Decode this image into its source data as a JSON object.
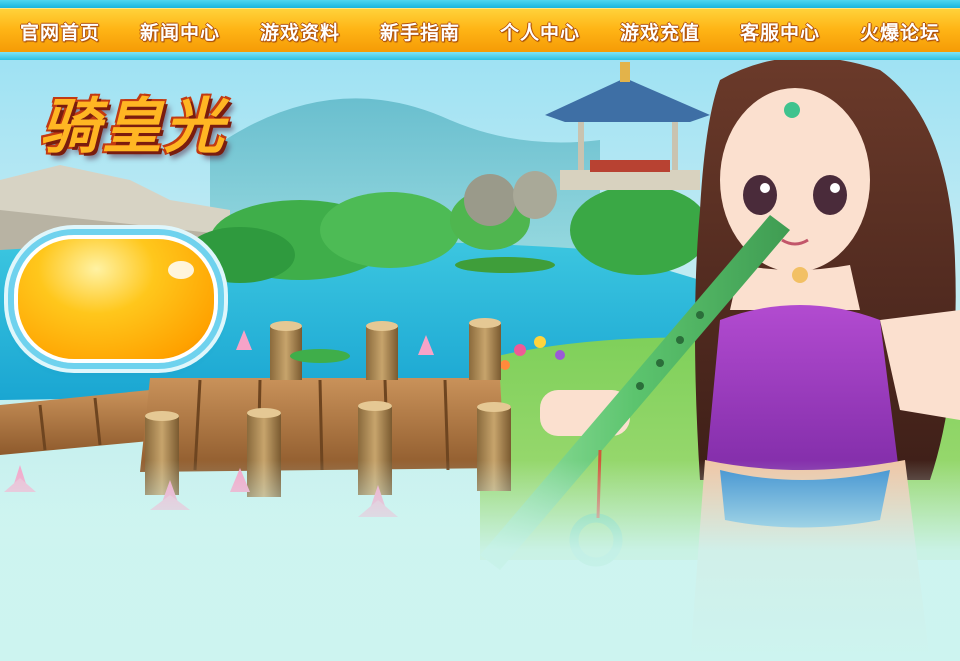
{
  "nav": {
    "items": [
      {
        "label": "官网首页"
      },
      {
        "label": "新闻中心"
      },
      {
        "label": "游戏资料"
      },
      {
        "label": "新手指南"
      },
      {
        "label": "个人中心"
      },
      {
        "label": "游戏充值"
      },
      {
        "label": "客服中心"
      },
      {
        "label": "火爆论坛"
      }
    ]
  },
  "banner": {
    "logo_text": "骑皇光"
  },
  "colors": {
    "nav_bg": "#ffb516",
    "nav_accent": "#19b5dd",
    "button": "#ffa200"
  }
}
